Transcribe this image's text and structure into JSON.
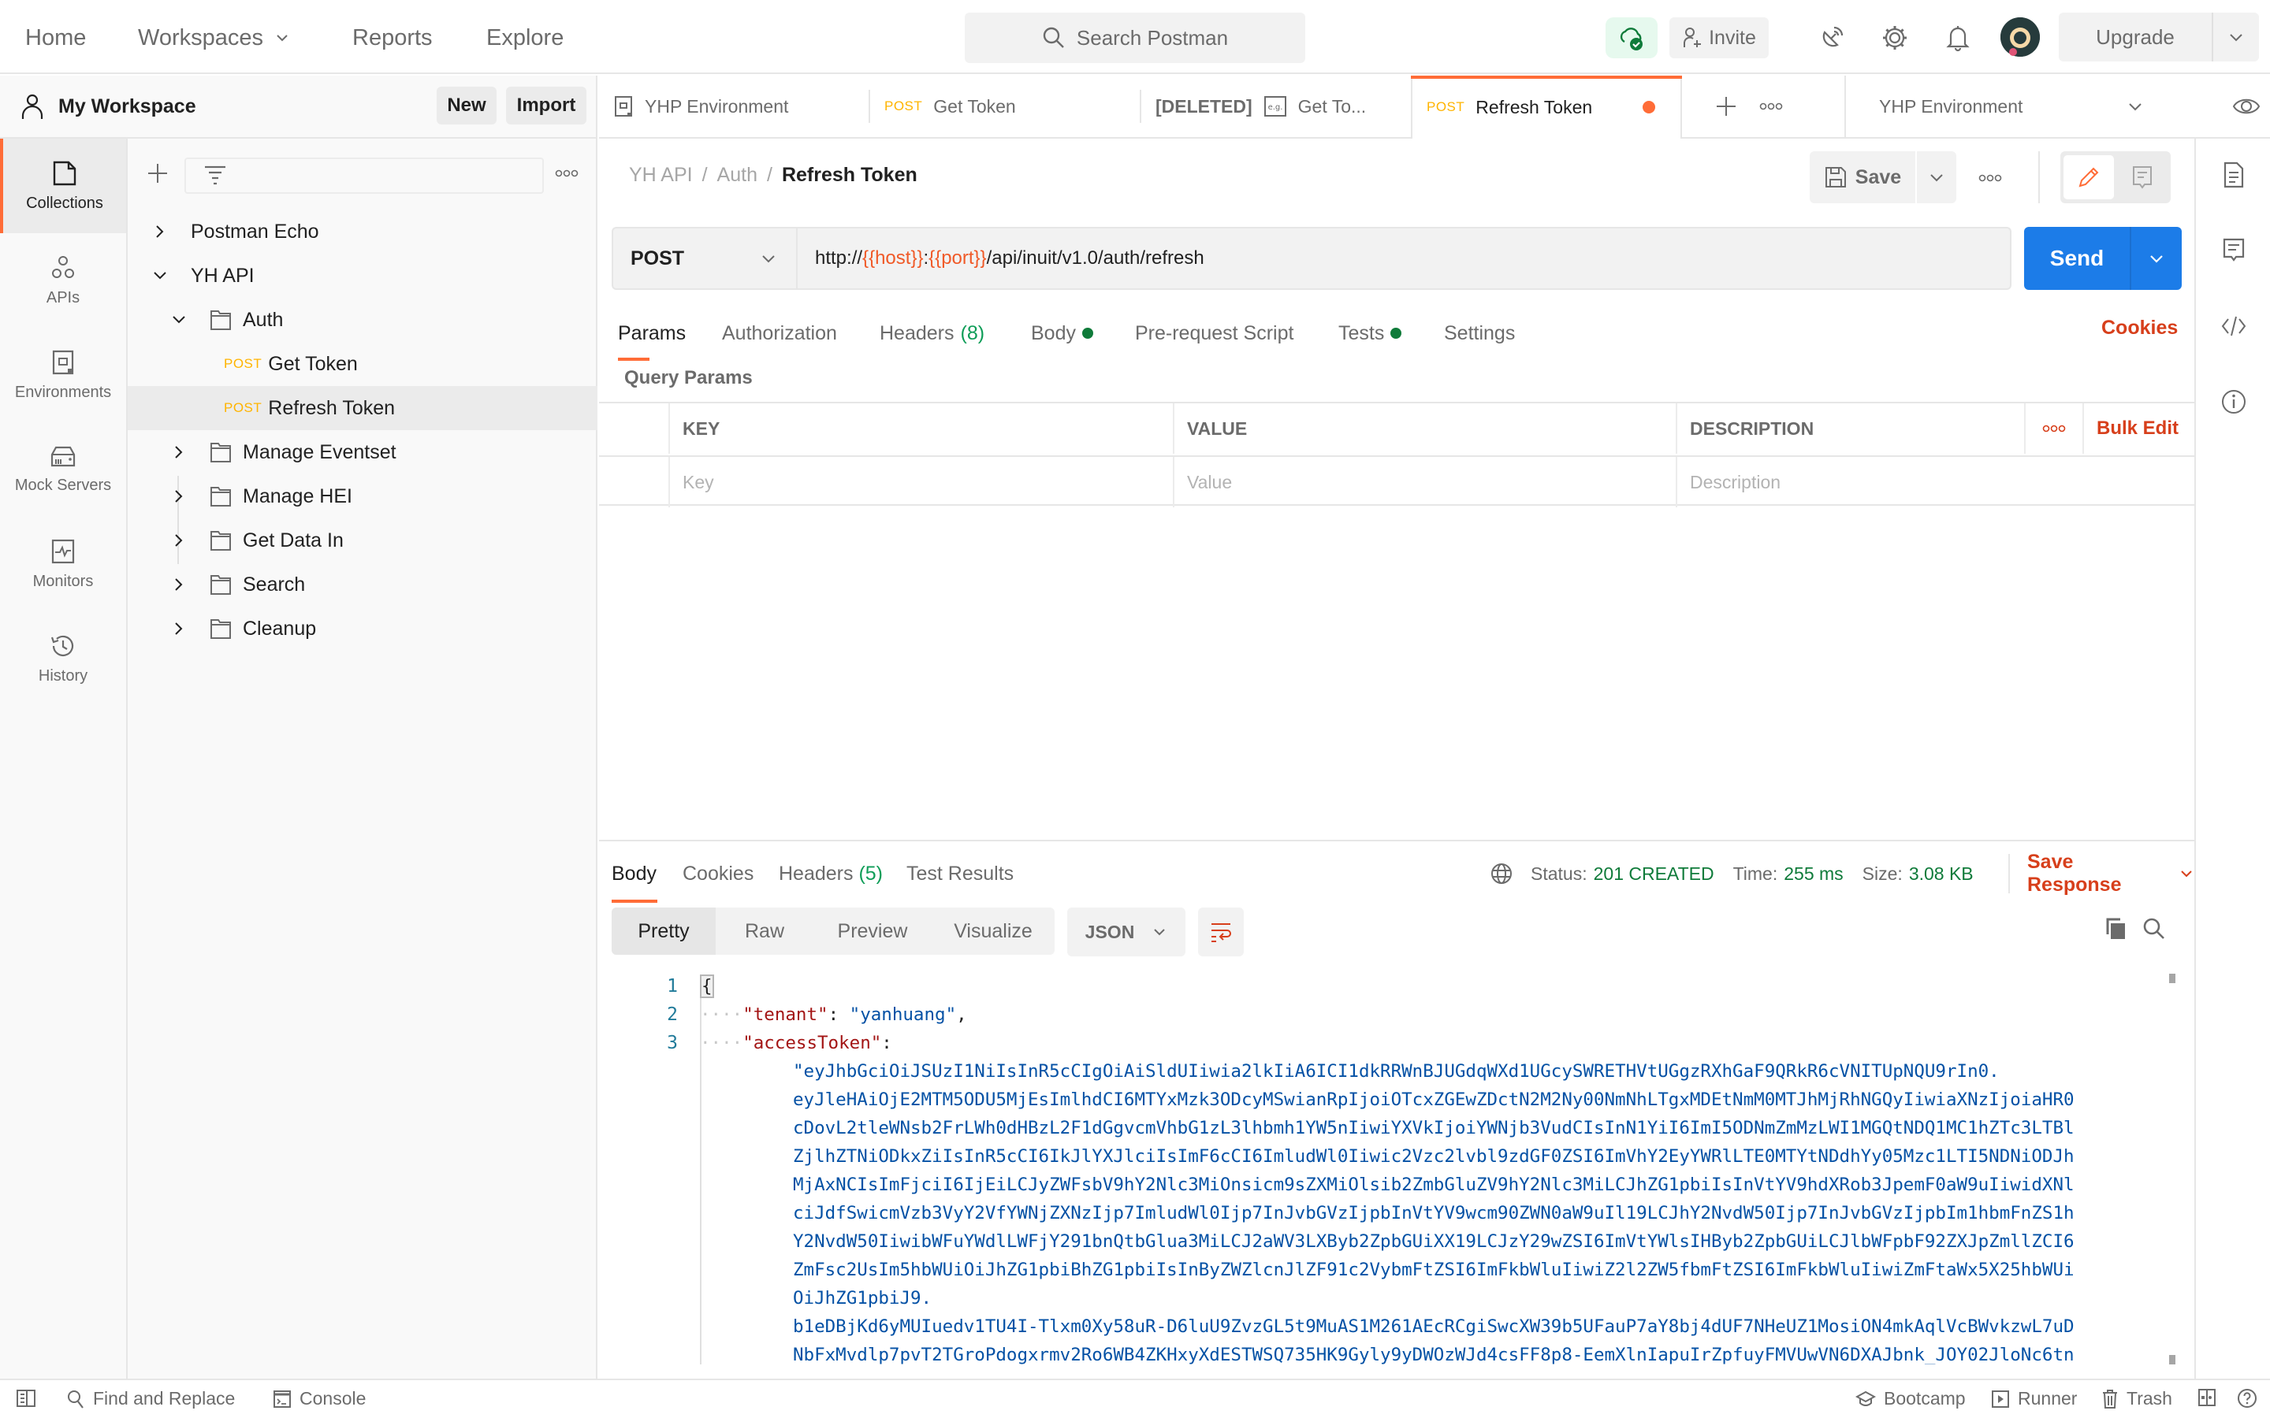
{
  "topnav": {
    "links": [
      "Home",
      "Workspaces",
      "Reports",
      "Explore"
    ],
    "search_placeholder": "Search Postman",
    "invite_label": "Invite",
    "upgrade_label": "Upgrade",
    "icons": [
      "sync-status-icon",
      "satellite-icon",
      "gear-icon",
      "bell-icon",
      "avatar"
    ]
  },
  "workspace": {
    "title": "My Workspace",
    "new_label": "New",
    "import_label": "Import"
  },
  "rail": {
    "items": [
      {
        "label": "Collections",
        "icon": "collections-icon",
        "active": true
      },
      {
        "label": "APIs",
        "icon": "apis-icon",
        "active": false
      },
      {
        "label": "Environments",
        "icon": "environments-icon",
        "active": false
      },
      {
        "label": "Mock Servers",
        "icon": "mock-servers-icon",
        "active": false
      },
      {
        "label": "Monitors",
        "icon": "monitors-icon",
        "active": false
      },
      {
        "label": "History",
        "icon": "history-icon",
        "active": false
      }
    ]
  },
  "tree": {
    "items": [
      {
        "label": "Postman Echo",
        "type": "collection",
        "expanded": false
      },
      {
        "label": "YH API",
        "type": "collection",
        "expanded": true
      },
      {
        "label": "Auth",
        "type": "folder",
        "expanded": true
      },
      {
        "label": "Get Token",
        "type": "request",
        "method": "POST"
      },
      {
        "label": "Refresh Token",
        "type": "request",
        "method": "POST",
        "selected": true
      },
      {
        "label": "Manage Eventset",
        "type": "folder",
        "expanded": false
      },
      {
        "label": "Manage HEI",
        "type": "folder",
        "expanded": false
      },
      {
        "label": "Get Data In",
        "type": "folder",
        "expanded": false
      },
      {
        "label": "Search",
        "type": "folder",
        "expanded": false
      },
      {
        "label": "Cleanup",
        "type": "folder",
        "expanded": false
      }
    ]
  },
  "tabs": [
    {
      "label": "YHP Environment",
      "kind": "environment"
    },
    {
      "label": "Get Token",
      "method": "POST"
    },
    {
      "prefix": "[DELETED]",
      "label": "Get To...",
      "kind": "example"
    },
    {
      "label": "Refresh Token",
      "method": "POST",
      "active": true,
      "unsaved": true
    }
  ],
  "environment_selector": {
    "value": "YHP Environment"
  },
  "request": {
    "breadcrumb": [
      "YH API",
      "Auth",
      "Refresh Token"
    ],
    "save_label": "Save",
    "method": "POST",
    "url": {
      "prefix": "http://",
      "host_var": "{{host}}",
      "sep": ":",
      "port_var": "{{port}}",
      "path": "/api/inuit/v1.0/auth/refresh"
    },
    "send_label": "Send",
    "tabs": [
      {
        "label": "Params",
        "active": true
      },
      {
        "label": "Authorization"
      },
      {
        "label": "Headers",
        "count": "(8)"
      },
      {
        "label": "Body",
        "dot": true
      },
      {
        "label": "Pre-request Script"
      },
      {
        "label": "Tests",
        "dot": true
      },
      {
        "label": "Settings"
      }
    ],
    "cookies_label": "Cookies",
    "query_params_label": "Query Params",
    "params_table": {
      "headers": [
        "KEY",
        "VALUE",
        "DESCRIPTION"
      ],
      "bulk_edit_label": "Bulk Edit",
      "placeholders": [
        "Key",
        "Value",
        "Description"
      ]
    }
  },
  "response": {
    "tabs": [
      {
        "label": "Body",
        "active": true
      },
      {
        "label": "Cookies"
      },
      {
        "label": "Headers",
        "count": "(5)"
      },
      {
        "label": "Test Results"
      }
    ],
    "status_label": "Status:",
    "status_value": "201 CREATED",
    "time_label": "Time:",
    "time_value": "255 ms",
    "size_label": "Size:",
    "size_value": "3.08 KB",
    "save_response_label": "Save Response",
    "view_modes": [
      "Pretty",
      "Raw",
      "Preview",
      "Visualize"
    ],
    "active_view": "Pretty",
    "format": "JSON",
    "line_numbers": [
      "1",
      "2",
      "3"
    ],
    "body": {
      "open_brace": "{",
      "tenant_key": "\"tenant\"",
      "tenant_value": "\"yanhuang\"",
      "access_token_key": "\"accessToken\"",
      "access_token_lines": [
        "\"eyJhbGciOiJSUzI1NiIsInR5cCIgOiAiSldUIiwia2lkIiA6ICI1dkRRWnBJUGdqWXd1UGcySWRETHVtUGgzRXhGaF9QRkR6cVNITUpNQU9rIn0.",
        "eyJleHAiOjE2MTM5ODU5MjEsImlhdCI6MTYxMzk3ODcyMSwianRpIjoiOTcxZGEwZDctN2M2Ny00NmNhLTgxMDEtNmM0MTJhMjRhNGQyIiwiaXNzIjoiaHR0",
        "cDovL2tleWNsb2FrLWh0dHBzL2F1dGgvcmVhbG1zL3lhbmh1YW5nIiwiYXVkIjoiYWNjb3VudCIsInN1YiI6ImI5ODNmZmMzLWI1MGQtNDQ1MC1hZTc3LTBl",
        "ZjlhZTNiODkxZiIsInR5cCI6IkJlYXJlciIsImF6cCI6ImludWl0Iiwic2Vzc2lvbl9zdGF0ZSI6ImVhY2EyYWRlLTE0MTYtNDdhYy05Mzc1LTI5NDNiODJh",
        "MjAxNCIsImFjciI6IjEiLCJyZWFsbV9hY2Nlc3MiOnsicm9sZXMiOlsib2ZmbGluZV9hY2Nlc3MiLCJhZG1pbiIsInVtYV9hdXRob3JpemF0aW9uIiwidXNl",
        "ciJdfSwicmVzb3VyY2VfYWNjZXNzIjp7ImludWl0Ijp7InJvbGVzIjpbInVtYV9wcm90ZWN0aW9uIl19LCJhY2NvdW50Ijp7InJvbGVzIjpbIm1hbmFnZS1h",
        "Y2NvdW50IiwibWFuYWdlLWFjY291bnQtbGlua3MiLCJ2aWV3LXByb2ZpbGUiXX19LCJzY29wZSI6ImVtYWlsIHByb2ZpbGUiLCJlbWFpbF92ZXJpZmllZCI6",
        "ZmFsc2UsIm5hbWUiOiJhZG1pbiBhZG1pbiIsInByZWZlcnJlZF91c2VybmFtZSI6ImFkbWluIiwiZ2l2ZW5fbmFtZSI6ImFkbWluIiwiZmFtaWx5X25hbWUi",
        "OiJhZG1pbiJ9.",
        "b1eDBjKd6yMUIuedv1TU4I-Tlxm0Xy58uR-D6luU9ZvzGL5t9MuAS1M261AEcRCgiSwcXW39b5UFauP7aY8bj4dUF7NHeUZ1MosiON4mkAqlVcBWvkzwL7uD",
        "NbFxMvdlp7pvT2TGroPdogxrmv2Ro6WB4ZKHxyXdESTWSQ735HK9Gyly9yDWOzWJd4csFF8p8-EemXlnIapuIrZpfuyFMVUwVN6DXAJbnk_JOY02JloNc6tn"
      ]
    }
  },
  "footer": {
    "left": [
      "Find and Replace",
      "Console"
    ],
    "right": [
      "Bootcamp",
      "Runner",
      "Trash"
    ]
  },
  "colors": {
    "accent": "#ff6c37",
    "send_blue": "#1c7ce8",
    "method_post": "#ffb400",
    "status_ok": "#0f7b3a",
    "link_red": "#d73f1b",
    "json_key": "#a31515",
    "json_string": "#0451a5"
  }
}
